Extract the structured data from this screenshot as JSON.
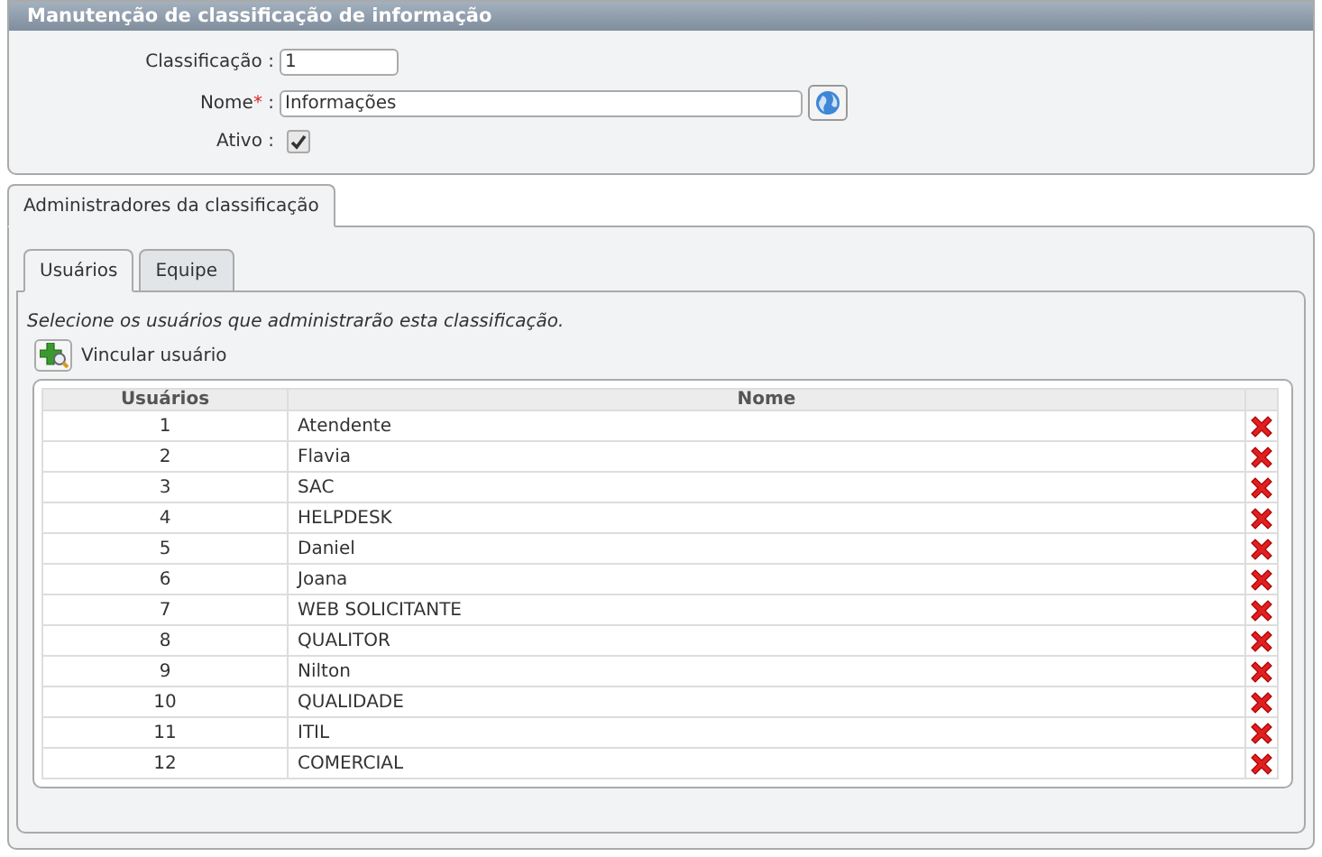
{
  "form": {
    "title": "Manutenção de classificação de informação",
    "fields": [
      {
        "kind": "text",
        "label": "Classificação",
        "separator": ":",
        "value": "1"
      },
      {
        "kind": "lookup",
        "label": "Nome",
        "required_mark": "*",
        "separator": ":",
        "value": "Informações"
      },
      {
        "kind": "checkbox",
        "label": "Ativo",
        "separator": ":",
        "checked": true
      }
    ]
  },
  "outer_tabs": [
    {
      "label": "Administradores da classificação",
      "selected": true
    }
  ],
  "inner_tabs": [
    {
      "label": "Usuários",
      "selected": true
    },
    {
      "label": "Equipe",
      "selected": false
    }
  ],
  "instructions": "Selecione os usuários que administrarão esta classificação.",
  "link_button": "Vincular usuário",
  "table": {
    "columns": [
      "Usuários",
      "Nome"
    ],
    "rows": [
      [
        "1",
        "Atendente"
      ],
      [
        "2",
        "Flavia"
      ],
      [
        "3",
        "SAC"
      ],
      [
        "4",
        "HELPDESK"
      ],
      [
        "5",
        "Daniel"
      ],
      [
        "6",
        "Joana"
      ],
      [
        "7",
        "WEB SOLICITANTE"
      ],
      [
        "8",
        "QUALITOR"
      ],
      [
        "9",
        "Nilton"
      ],
      [
        "10",
        "QUALIDADE"
      ],
      [
        "11",
        "ITIL"
      ],
      [
        "12",
        "COMERCIAL"
      ]
    ]
  }
}
